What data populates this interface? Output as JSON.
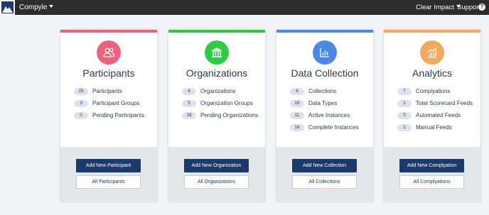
{
  "app": {
    "name": "Compyle",
    "logo_icon": "mountain-logo-icon"
  },
  "header": {
    "org_label": "Clear Impact",
    "support_label": "Support",
    "help_icon": "question-circle-icon"
  },
  "cards": [
    {
      "title": "Participants",
      "accent": "#f0607b",
      "icon": "users-icon",
      "stats": [
        {
          "count": "25",
          "label": "Participants"
        },
        {
          "count": "3",
          "label": "Participant Groups"
        },
        {
          "count": "0",
          "label": "Pending Participants"
        }
      ],
      "primary_button": "Add New Participant",
      "secondary_button": "All Participants"
    },
    {
      "title": "Organizations",
      "accent": "#2ecc40",
      "icon": "bank-icon",
      "stats": [
        {
          "count": "4",
          "label": "Organizations"
        },
        {
          "count": "5",
          "label": "Organization Groups"
        },
        {
          "count": "18",
          "label": "Pending Organizations"
        }
      ],
      "primary_button": "Add New Organization",
      "secondary_button": "All Organizations"
    },
    {
      "title": "Data Collection",
      "accent": "#4a88e8",
      "icon": "bar-chart-icon",
      "stats": [
        {
          "count": "6",
          "label": "Collections"
        },
        {
          "count": "19",
          "label": "Data Types"
        },
        {
          "count": "11",
          "label": "Active Instances"
        },
        {
          "count": "18",
          "label": "Complete Instances"
        }
      ],
      "primary_button": "Add New Collection",
      "secondary_button": "All Collections"
    },
    {
      "title": "Analytics",
      "accent": "#f0a95e",
      "icon": "analytics-chart-icon",
      "stats": [
        {
          "count": "7",
          "label": "Complyations"
        },
        {
          "count": "1",
          "label": "Total Scorecard Feeds"
        },
        {
          "count": "0",
          "label": "Automated Feeds"
        },
        {
          "count": "1",
          "label": "Manual Feeds"
        }
      ],
      "primary_button": "Add New Complyation",
      "secondary_button": "All Complyations"
    }
  ]
}
